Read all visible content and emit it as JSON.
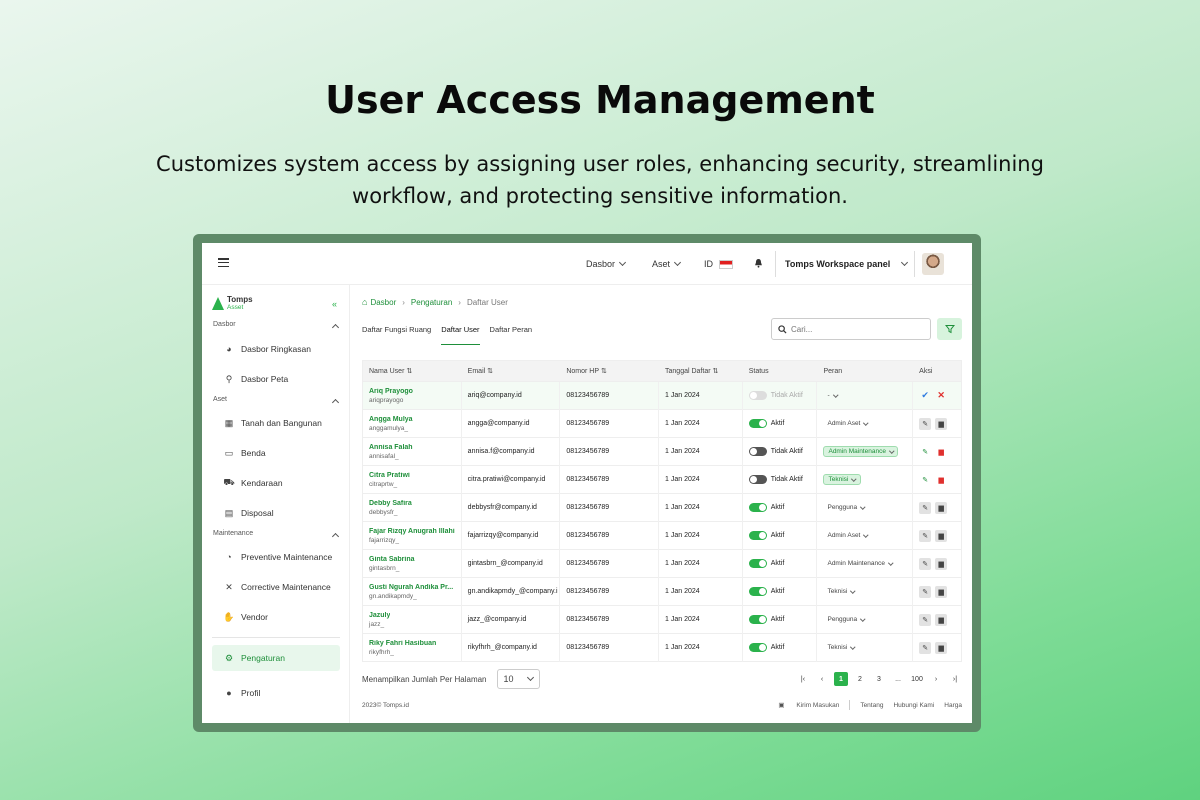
{
  "hero": {
    "title": "User Access Management",
    "subtitle": "Customizes system access by assigning user roles, enhancing security, streamlining workflow, and protecting sensitive information."
  },
  "topbar": {
    "nav_dasbor": "Dasbor",
    "nav_aset": "Aset",
    "lang": "ID",
    "workspace": "Tomps Workspace panel"
  },
  "sidebar": {
    "logo_name": "Tomps",
    "logo_sub": "Asset",
    "sections": {
      "dasbor": "Dasbor",
      "aset": "Aset",
      "maintenance": "Maintenance"
    },
    "items": {
      "dasbor_ringkasan": "Dasbor Ringkasan",
      "dasbor_peta": "Dasbor Peta",
      "tanah": "Tanah dan Bangunan",
      "benda": "Benda",
      "kendaraan": "Kendaraan",
      "disposal": "Disposal",
      "preventive": "Preventive Maintenance",
      "corrective": "Corrective Maintenance",
      "vendor": "Vendor",
      "pengaturan": "Pengaturan",
      "profil": "Profil"
    }
  },
  "breadcrumb": {
    "home": "Dasbor",
    "level2": "Pengaturan",
    "current": "Daftar User"
  },
  "tabs": [
    "Daftar Fungsi Ruang",
    "Daftar User",
    "Daftar Peran"
  ],
  "search": {
    "placeholder": "Cari..."
  },
  "table": {
    "headers": [
      "Nama User",
      "Email",
      "Nomor HP",
      "Tanggal Daftar",
      "Status",
      "Peran",
      "Aksi"
    ],
    "rows": [
      {
        "name": "Ariq Prayogo",
        "handle": "ariqprayogo",
        "email": "ariq@company.id",
        "phone": "08123456789",
        "date": "1 Jan 2024",
        "status": "Tidak Aktif",
        "role": "-"
      },
      {
        "name": "Angga Mulya",
        "handle": "anggamulya_",
        "email": "angga@company.id",
        "phone": "08123456789",
        "date": "1 Jan 2024",
        "status": "Aktif",
        "role": "Admin Aset"
      },
      {
        "name": "Annisa Falah",
        "handle": "annisafal_",
        "email": "annisa.f@company.id",
        "phone": "08123456789",
        "date": "1 Jan 2024",
        "status": "Tidak Aktif",
        "role": "Admin Maintenance"
      },
      {
        "name": "Citra Pratiwi",
        "handle": "citraprtw_",
        "email": "citra.pratiwi@company.id",
        "phone": "08123456789",
        "date": "1 Jan 2024",
        "status": "Tidak Aktif",
        "role": "Teknisi"
      },
      {
        "name": "Debby Safira",
        "handle": "debbysfr_",
        "email": "debbysfr@company.id",
        "phone": "08123456789",
        "date": "1 Jan 2024",
        "status": "Aktif",
        "role": "Pengguna"
      },
      {
        "name": "Fajar Rizqy Anugrah Illahi",
        "handle": "fajarrizqy_",
        "email": "fajarrizqy@company.id",
        "phone": "08123456789",
        "date": "1 Jan 2024",
        "status": "Aktif",
        "role": "Admin Aset"
      },
      {
        "name": "Ginta Sabrina",
        "handle": "gintasbrn_",
        "email": "gintasbrn_@company.id",
        "phone": "08123456789",
        "date": "1 Jan 2024",
        "status": "Aktif",
        "role": "Admin Maintenance"
      },
      {
        "name": "Gusti Ngurah Andika Pr...",
        "handle": "gn.andikapmdy_",
        "email": "gn.andikapmdy_@company.i",
        "phone": "08123456789",
        "date": "1 Jan 2024",
        "status": "Aktif",
        "role": "Teknisi"
      },
      {
        "name": "Jazuly",
        "handle": "jazz_",
        "email": "jazz_@company.id",
        "phone": "08123456789",
        "date": "1 Jan 2024",
        "status": "Aktif",
        "role": "Pengguna"
      },
      {
        "name": "Riky Fahri Hasibuan",
        "handle": "rikyfhrh_",
        "email": "rikyfhrh_@company.id",
        "phone": "08123456789",
        "date": "1 Jan 2024",
        "status": "Aktif",
        "role": "Teknisi"
      }
    ]
  },
  "pagination": {
    "per_page_label": "Menampilkan Jumlah Per Halaman",
    "per_page_value": "10",
    "pages": [
      "1",
      "2",
      "3",
      "...",
      "100"
    ]
  },
  "footer": {
    "copyright": "2023© Tomps.id",
    "feedback": "Kirim Masukan",
    "about": "Tentang",
    "contact": "Hubungi Kami",
    "pricing": "Harga"
  },
  "colors": {
    "accent": "#2bb24c",
    "accent_dark": "#1e8f3a",
    "danger": "#e0302e"
  }
}
